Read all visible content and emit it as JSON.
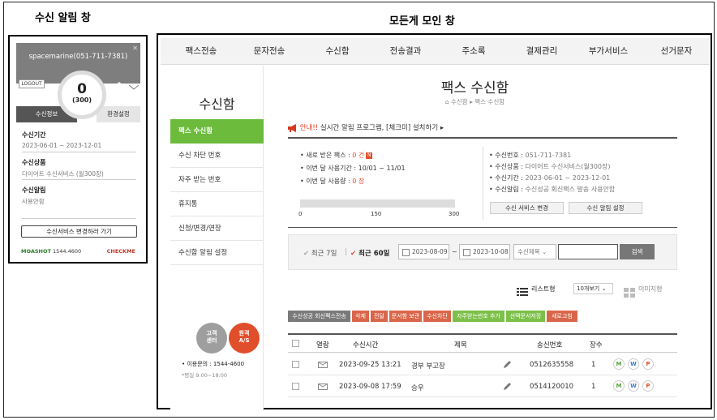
{
  "labels": {
    "popup_section": "수신 알림 창",
    "main_section": "모든게 모인 창"
  },
  "popup": {
    "phone": "spacemarine(051-711-7381)",
    "logout": "LOGOUT",
    "count": "0",
    "count_total": "(300)",
    "tabs": [
      "수신정보",
      "환경설정"
    ],
    "info": [
      {
        "label": "수신기간",
        "value": "2023-06-01 ~ 2023-12-01"
      },
      {
        "label": "수신상품",
        "value": "다이어트 수신서비스 (월300장)"
      },
      {
        "label": "수신알림",
        "value": "사용안함"
      }
    ],
    "change_button": "수신서비스 변경하러 가기",
    "brand": "MOASHOT",
    "brand_phone": "1544.4600",
    "checkme": "CHECKME"
  },
  "nav": {
    "items": [
      "팩스전송",
      "문자전송",
      "수신함",
      "전송결과",
      "주소록",
      "결제관리",
      "부가서비스",
      "선거문자"
    ]
  },
  "sidebar": {
    "title": "수신함",
    "items": [
      "팩스 수신함",
      "수신 차단 번호",
      "자주 받는 번호",
      "휴지통",
      "신청/변경/연장",
      "수신함 알림 설정"
    ],
    "btn_center": [
      "고객",
      "센터"
    ],
    "btn_remote": [
      "원격",
      "A/S"
    ],
    "contact": "• 이용문의 : 1544-4600",
    "hours": "*평일 9:00~18:00"
  },
  "main": {
    "title": "팩스 수신함",
    "breadcrumb": "⌂ 수신함 ▸ 팩스 수신함",
    "notice_prefix": "안내!!",
    "notice_text": " 실시간 알림 프로그램, [체크미] 설치하기 ▸",
    "stats_left": [
      {
        "label": "• 새로 받은 팩스 : ",
        "value": "0 건"
      },
      {
        "label": "• 이번 달 사용기간 : ",
        "value": "10/01 ~ 11/01"
      },
      {
        "label": "• 이번 달 사용량 : ",
        "value": "0 장"
      }
    ],
    "usage_ticks": [
      "0",
      "150",
      "300"
    ],
    "usage_fraction": 0,
    "stats_right": [
      {
        "label": "• 수신번호 : ",
        "value": "051-711-7381"
      },
      {
        "label": "• 수신상품 : ",
        "value": "다이어트 수신서비스(월300장)"
      },
      {
        "label": "• 수신기간 : ",
        "value": "2023-06-01 ~ 2023-12-01"
      },
      {
        "label": "• 수신알림 : ",
        "value": "수신성공 회신팩스 발송 사용안함"
      }
    ],
    "btn_change_service": "수신 서비스 변경",
    "btn_alert_setting": "수신 알림 설정"
  },
  "filter": {
    "recent7": "최근 7일",
    "recent60": "최근 60일",
    "date_from": "2023-08-09",
    "date_to": "2023-10-08",
    "tilde": "~",
    "select": "수신제목",
    "search": "검색"
  },
  "view": {
    "list": "리스트형",
    "per_page": "10개보기",
    "image": "이미지형"
  },
  "actions": [
    {
      "label": "수신성공 회신팩스전송",
      "color": "#7a7a7a"
    },
    {
      "label": "삭제",
      "color": "#d9664a"
    },
    {
      "label": "전달",
      "color": "#d9664a"
    },
    {
      "label": "문서함 보관",
      "color": "#d9664a"
    },
    {
      "label": "수신차단",
      "color": "#d9664a"
    },
    {
      "label": "자주받는번호 추가",
      "color": "#7cc04a"
    },
    {
      "label": "선택문서저장",
      "color": "#7cc04a"
    },
    {
      "label": "새로고침",
      "color": "#d9664a"
    }
  ],
  "table": {
    "headers": [
      "열람",
      "수신시간",
      "제목",
      "송신번호",
      "장수"
    ],
    "rows": [
      {
        "time": "2023-09-25 13:21",
        "title": "경부 부고장",
        "sender": "0512635558",
        "pages": "1"
      },
      {
        "time": "2023-09-08 17:59",
        "title": "승우",
        "sender": "0514120010",
        "pages": "1"
      }
    ],
    "row_buttons": [
      "M",
      "W",
      "P"
    ]
  }
}
